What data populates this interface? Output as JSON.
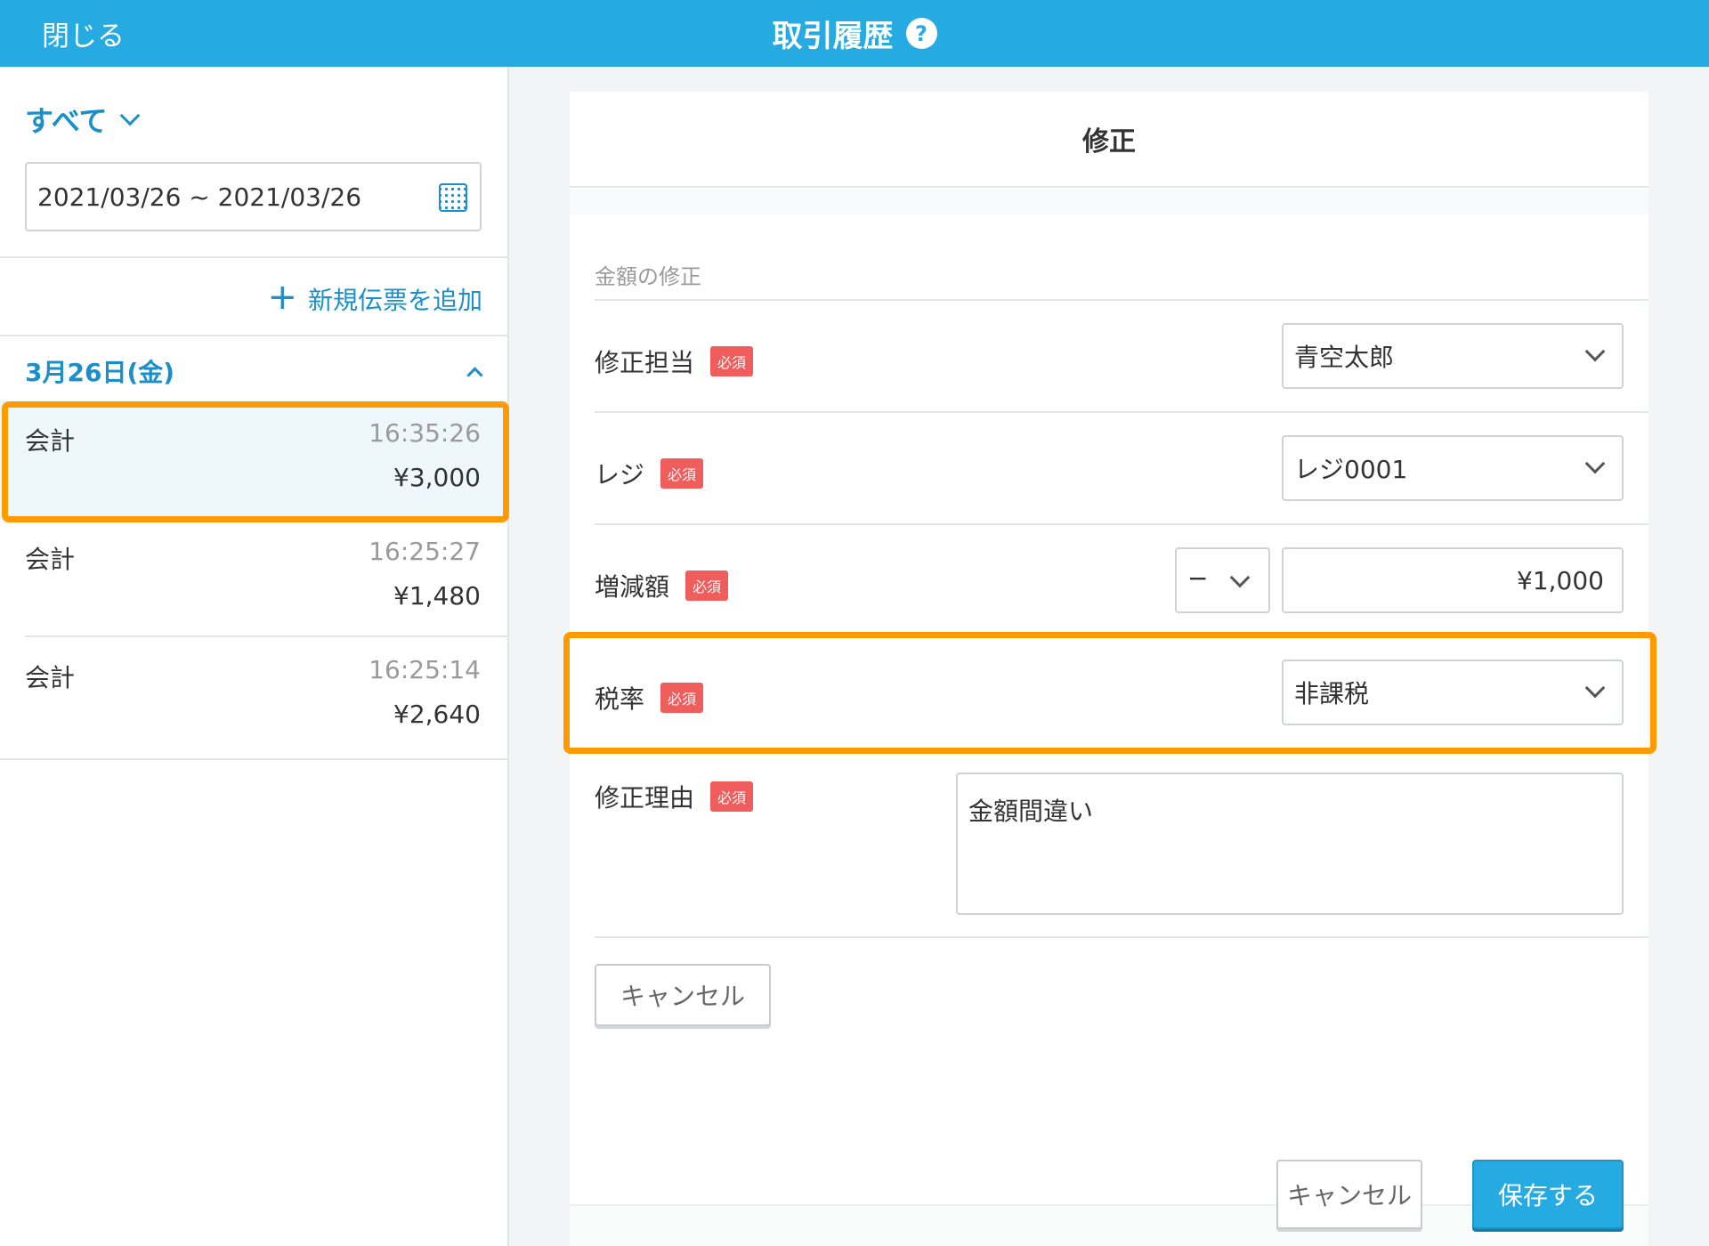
{
  "topbar": {
    "close_label": "閉じる",
    "title": "取引履歴",
    "help_glyph": "?",
    "background_color": "#25aae2"
  },
  "sidebar": {
    "filter_label": "すべて",
    "date_range": "2021/03/26 ~ 2021/03/26",
    "add_slip_label": "新規伝票を追加",
    "day_label": "3月26日(金)",
    "transactions": [
      {
        "label": "会計",
        "time": "16:35:26",
        "amount": "¥3,000",
        "selected": true
      },
      {
        "label": "会計",
        "time": "16:25:27",
        "amount": "¥1,480",
        "selected": false
      },
      {
        "label": "会計",
        "time": "16:25:14",
        "amount": "¥2,640",
        "selected": false
      }
    ]
  },
  "form": {
    "title": "修正",
    "section_label": "金額の修正",
    "required_badge": "必須",
    "fields": {
      "staff": {
        "label": "修正担当",
        "value": "青空太郎"
      },
      "register": {
        "label": "レジ",
        "value": "レジ0001"
      },
      "amount": {
        "label": "増減額",
        "sign": "−",
        "value": "¥1,000"
      },
      "tax_rate": {
        "label": "税率",
        "value": "非課税"
      },
      "reason": {
        "label": "修正理由",
        "value": "金額間違い"
      }
    },
    "inline_cancel_label": "キャンセル",
    "footer": {
      "cancel_label": "キャンセル",
      "save_label": "保存する"
    }
  },
  "colors": {
    "accent": "#25aae2",
    "highlight": "#ff9a00",
    "required_badge": "#f05d5d"
  },
  "icons": [
    "question-icon",
    "chevron-down-icon",
    "calendar-icon",
    "plus-icon",
    "chevron-up-icon"
  ]
}
